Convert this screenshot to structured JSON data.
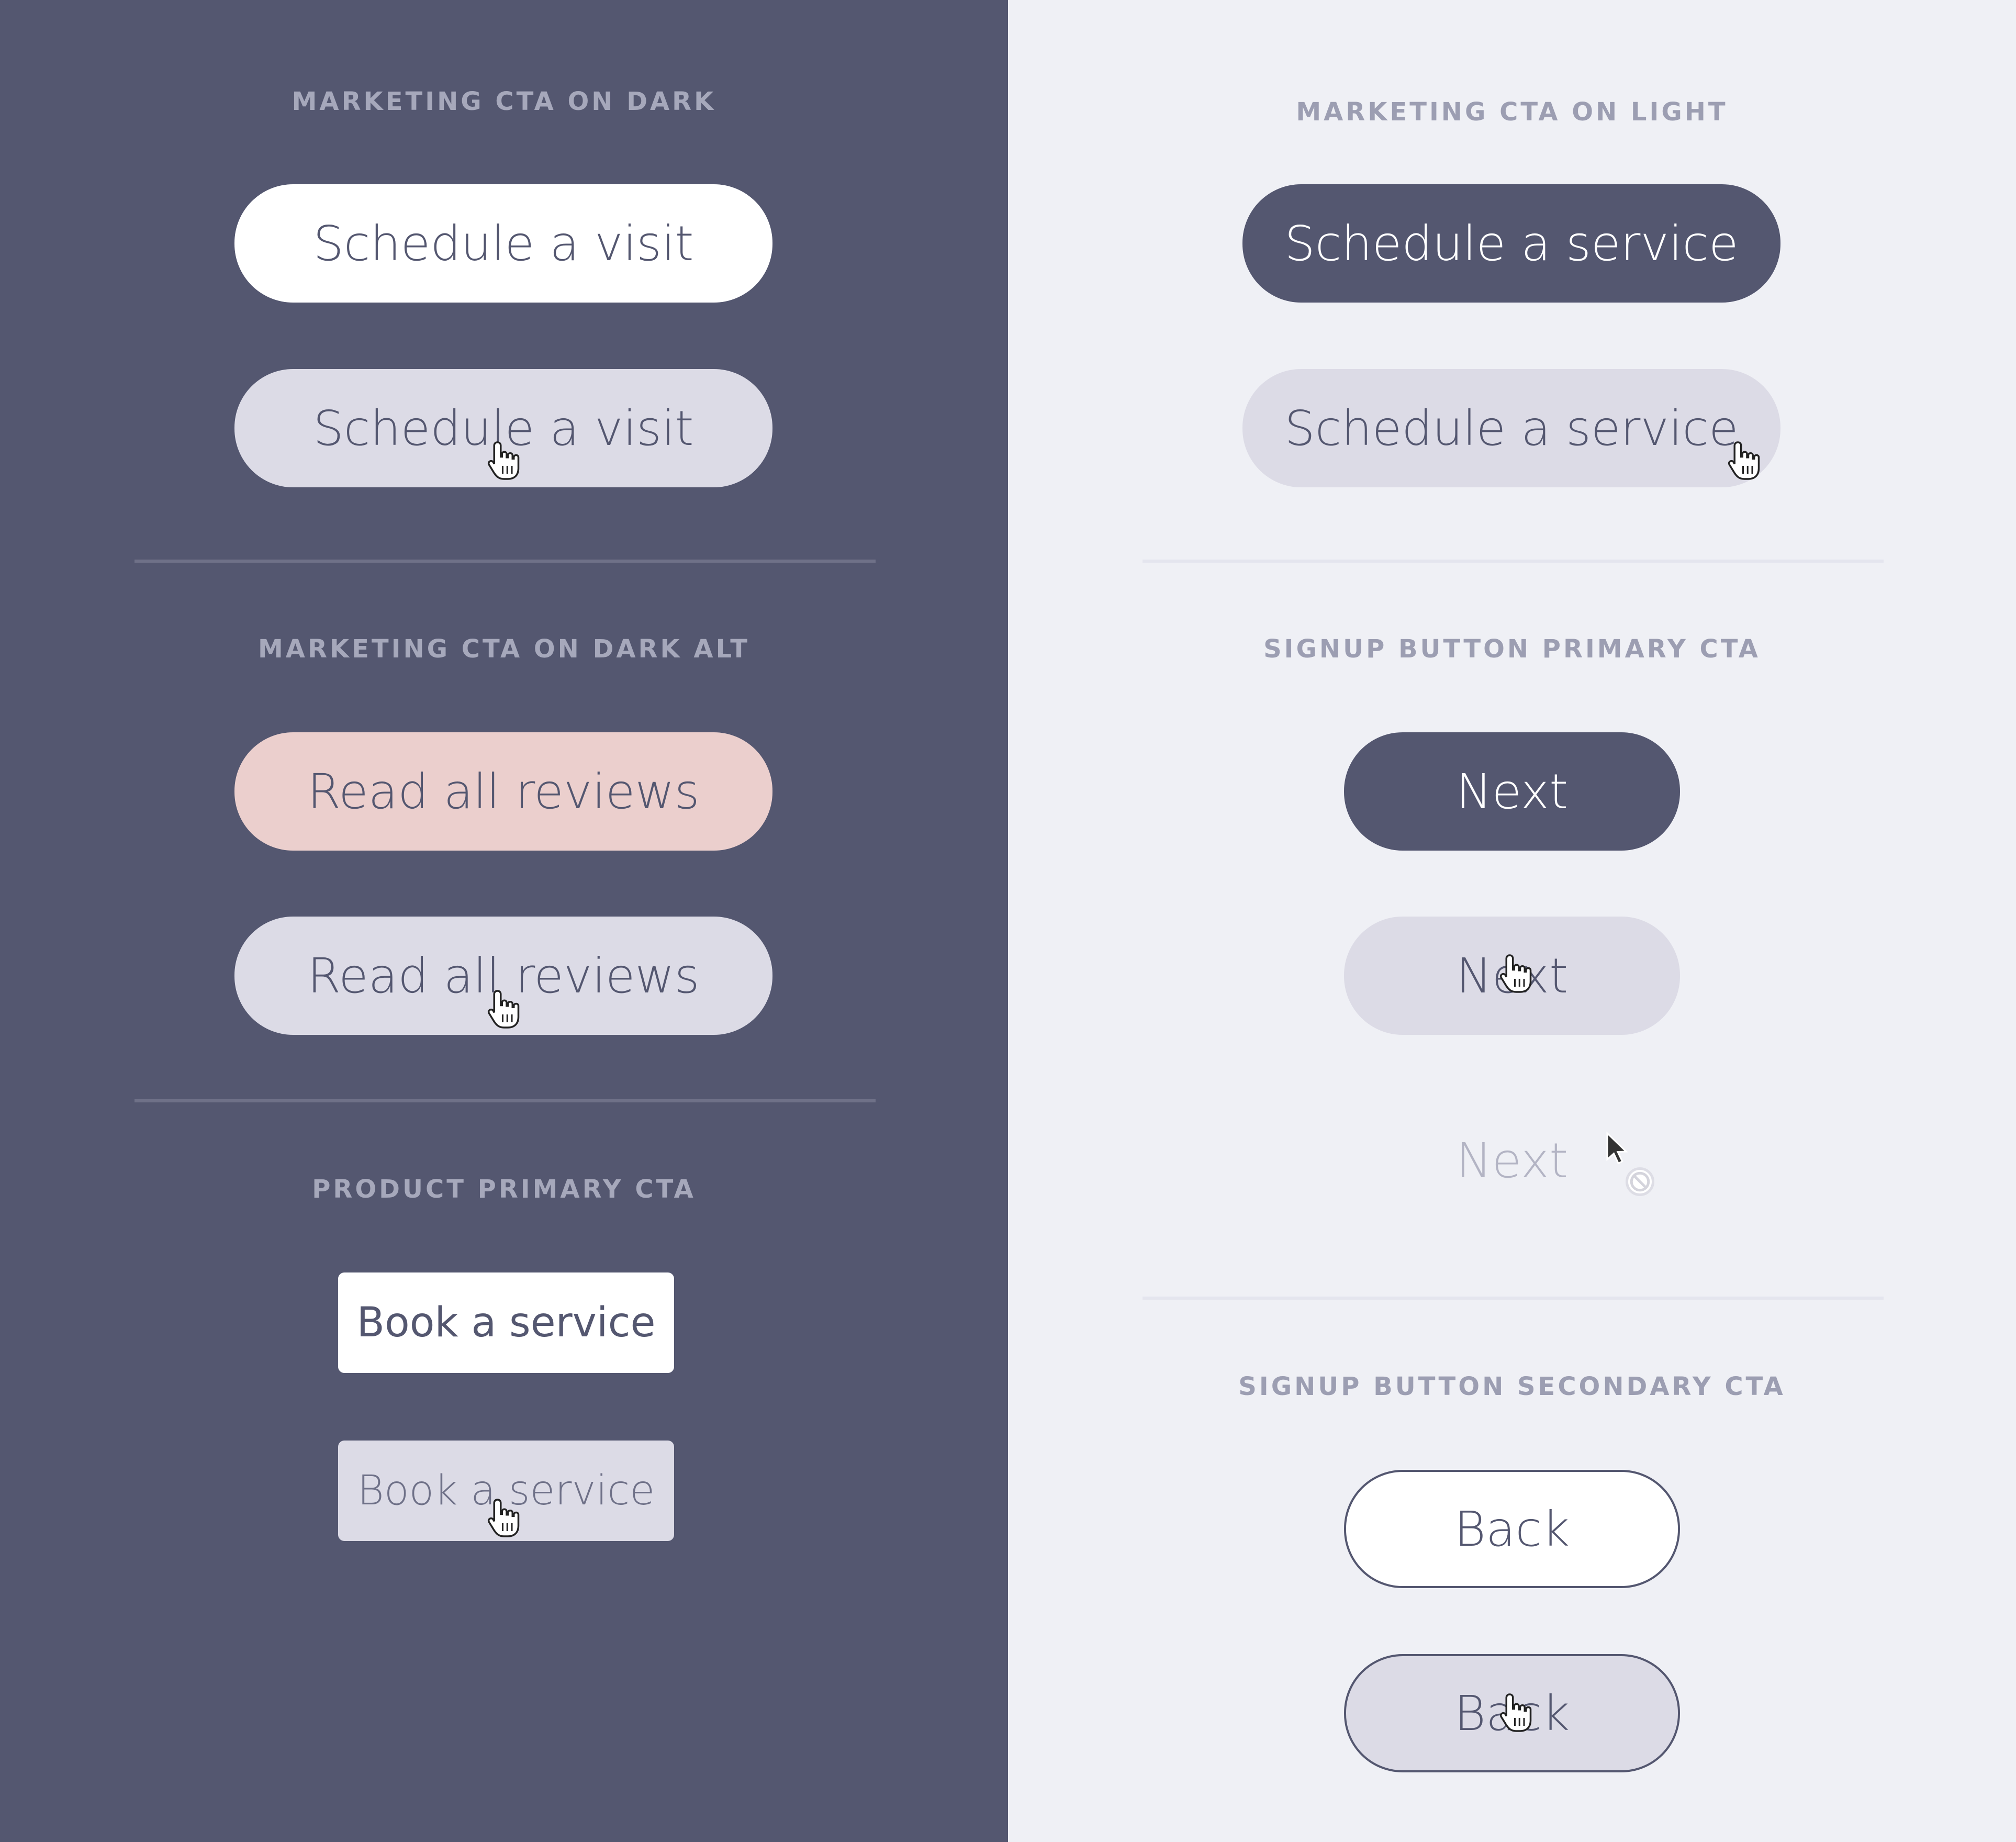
{
  "colors": {
    "dark_background": "#545770",
    "light_background": "#eff0f5",
    "dark_button": "#545770",
    "white_button": "#ffffff",
    "hover_lavender": "#dcdbe6",
    "pink_button": "#ebcfcd",
    "button_text": "#545770",
    "disabled_text": "#b3b4c4"
  },
  "dark_panel": {
    "marketing_on_dark": {
      "title": "MARKETING CTA ON DARK",
      "default_label": "Schedule a visit",
      "hover_label": "Schedule a visit"
    },
    "marketing_on_dark_alt": {
      "title": "MARKETING CTA ON DARK ALT",
      "default_label": "Read all reviews",
      "hover_label": "Read all reviews"
    },
    "product_primary": {
      "title": "PRODUCT PRIMARY CTA",
      "default_label": "Book a service",
      "hover_label": "Book a service"
    }
  },
  "light_panel": {
    "marketing_on_light": {
      "title": "MARKETING CTA ON LIGHT",
      "default_label": "Schedule a service",
      "hover_label": "Schedule a service"
    },
    "signup_primary": {
      "title": "SIGNUP BUTTON PRIMARY CTA",
      "default_label": "Next",
      "hover_label": "Next",
      "disabled_label": "Next"
    },
    "signup_secondary": {
      "title": "SIGNUP BUTTON SECONDARY CTA",
      "default_label": "Back",
      "hover_label": "Back"
    }
  },
  "icons": {
    "hover_cursor": "hand-pointer-cursor-icon",
    "disabled_cursor": "not-allowed-cursor-icon"
  }
}
